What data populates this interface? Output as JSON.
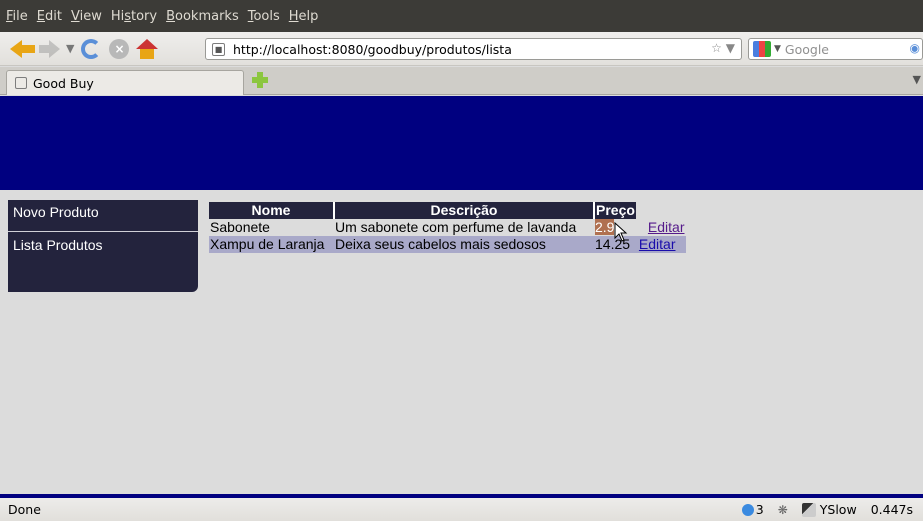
{
  "menubar": {
    "items": [
      {
        "pre": "",
        "key": "F",
        "post": "ile"
      },
      {
        "pre": "",
        "key": "E",
        "post": "dit"
      },
      {
        "pre": "",
        "key": "V",
        "post": "iew"
      },
      {
        "pre": "Hi",
        "key": "s",
        "post": "tory"
      },
      {
        "pre": "",
        "key": "B",
        "post": "ookmarks"
      },
      {
        "pre": "",
        "key": "T",
        "post": "ools"
      },
      {
        "pre": "",
        "key": "H",
        "post": "elp"
      }
    ]
  },
  "navbar": {
    "url": "http://localhost:8080/goodbuy/produtos/lista",
    "search_placeholder": "Google",
    "icons": [
      "back-arrow-icon",
      "forward-arrow-icon",
      "reload-icon",
      "stop-icon",
      "home-icon",
      "star-icon",
      "google-icon",
      "magnifier-icon"
    ]
  },
  "tabs": {
    "active_label": "Good Buy"
  },
  "page": {
    "banner_color": "#000080",
    "menu": [
      "Novo Produto",
      "Lista Produtos"
    ],
    "table": {
      "headers": [
        "Nome",
        "Descrição",
        "Preço"
      ],
      "rows": [
        {
          "nome": "Sabonete",
          "descricao": "Um sabonete com perfume de lavanda",
          "preco": "2.9",
          "action": "Editar"
        },
        {
          "nome": "Xampu de Laranja",
          "descricao": "Deixa seus cabelos mais sedosos",
          "preco": "14.25",
          "action": "Editar"
        }
      ]
    }
  },
  "statusbar": {
    "status": "Done",
    "count": "3",
    "yslow": "YSlow",
    "time": "0.447s"
  }
}
